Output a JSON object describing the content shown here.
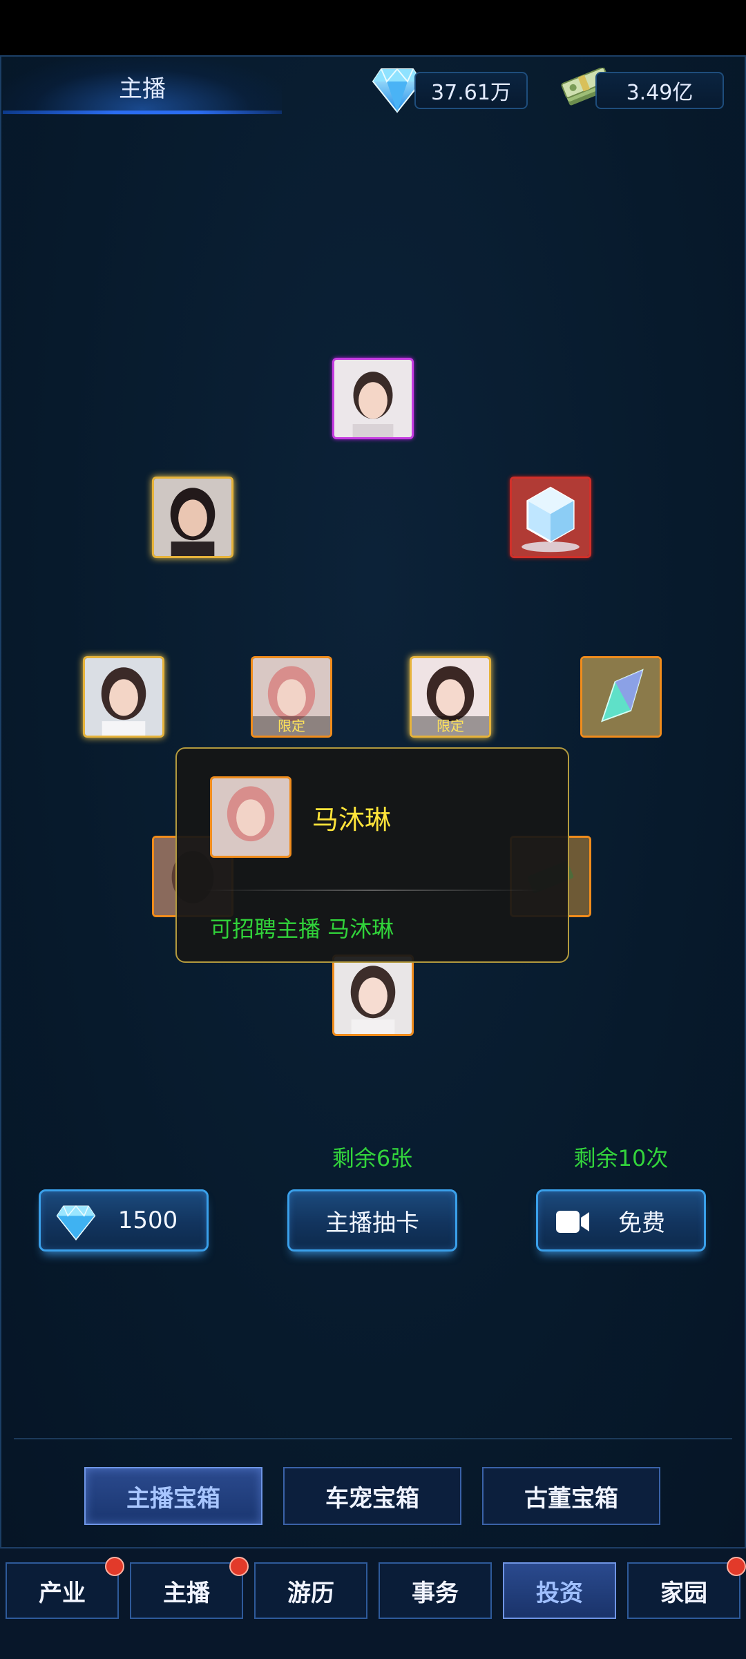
{
  "header": {
    "tab_label": "主播",
    "gems": "37.61万",
    "cash": "3.49亿"
  },
  "cards": [
    {
      "id": "top",
      "kind": "portrait",
      "border": "purple",
      "limited": false
    },
    {
      "id": "left-upper",
      "kind": "portrait",
      "border": "gold",
      "limited": false
    },
    {
      "id": "right-upper",
      "kind": "ice-cube",
      "border": "red",
      "limited": false
    },
    {
      "id": "row3-1",
      "kind": "portrait",
      "border": "gold",
      "limited": false
    },
    {
      "id": "row3-2",
      "kind": "portrait",
      "border": "orange",
      "limited": true
    },
    {
      "id": "row3-3",
      "kind": "portrait",
      "border": "gold",
      "limited": true
    },
    {
      "id": "row3-4",
      "kind": "crystal",
      "border": "orange",
      "limited": false
    },
    {
      "id": "bottom",
      "kind": "portrait",
      "border": "orange",
      "limited": false
    }
  ],
  "limited_label": "限定",
  "popup": {
    "name": "马沐琳",
    "description": "可招聘主播  马沐琳"
  },
  "actions": {
    "remaining_cards": "剩余6张",
    "remaining_free": "剩余10次",
    "gem_draw_cost": "1500",
    "draw_label": "主播抽卡",
    "free_label": "免费"
  },
  "chest_tabs": [
    {
      "label": "主播宝箱",
      "active": true
    },
    {
      "label": "车宠宝箱",
      "active": false
    },
    {
      "label": "古董宝箱",
      "active": false
    }
  ],
  "nav": [
    {
      "label": "产业",
      "active": false,
      "badge": true
    },
    {
      "label": "主播",
      "active": false,
      "badge": true
    },
    {
      "label": "游历",
      "active": false,
      "badge": false
    },
    {
      "label": "事务",
      "active": false,
      "badge": false
    },
    {
      "label": "投资",
      "active": true,
      "badge": false
    },
    {
      "label": "家园",
      "active": false,
      "badge": true
    }
  ],
  "icons": {
    "gem": "diamond-icon",
    "cash": "money-stack-icon",
    "video": "video-camera-icon"
  },
  "colors": {
    "accent_green": "#33d43c",
    "name_yellow": "#ffe43a",
    "button_blue": "#3aa0ea"
  }
}
